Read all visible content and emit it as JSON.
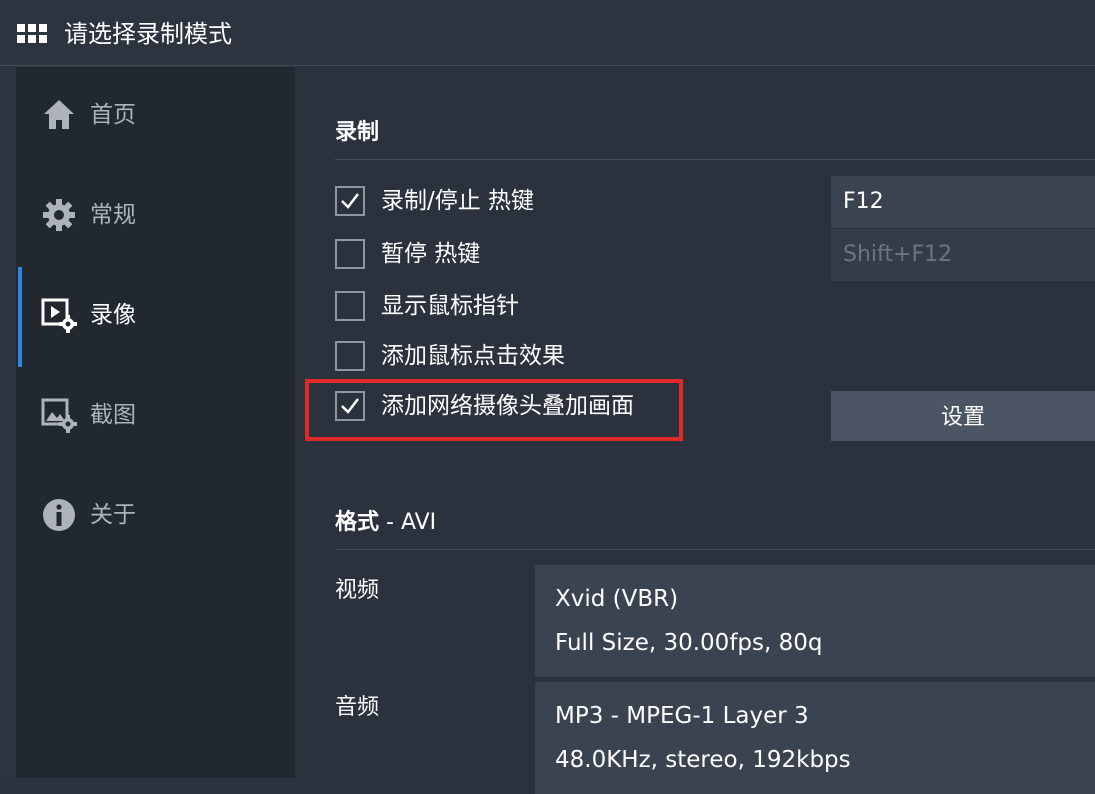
{
  "window": {
    "title": "请选择录制模式",
    "icon": "grid-icon"
  },
  "sidebar": {
    "items": [
      {
        "label": "首页",
        "icon": "home-icon",
        "active": false
      },
      {
        "label": "常规",
        "icon": "gear-icon",
        "active": false
      },
      {
        "label": "录像",
        "icon": "video-settings-icon",
        "active": true
      },
      {
        "label": "截图",
        "icon": "image-settings-icon",
        "active": false
      },
      {
        "label": "关于",
        "icon": "info-icon",
        "active": false
      }
    ],
    "active_color": "#2e86de"
  },
  "recording": {
    "section_title": "录制",
    "options": [
      {
        "label": "录制/停止 热键",
        "checked": true
      },
      {
        "label": "暂停 热键",
        "checked": false
      },
      {
        "label": "显示鼠标指针",
        "checked": false
      },
      {
        "label": "添加鼠标点击效果",
        "checked": false
      },
      {
        "label": "添加网络摄像头叠加画面",
        "checked": true
      }
    ],
    "record_hotkey": "F12",
    "pause_hotkey": "Shift+F12",
    "settings_label": "设置",
    "highlight_color": "#e02a2a"
  },
  "format": {
    "section_title": "格式",
    "section_suffix": " - AVI",
    "video_label": "视频",
    "video_codec": "Xvid (VBR)",
    "video_details": "Full Size, 30.00fps, 80q",
    "audio_label": "音频",
    "audio_codec": "MP3 - MPEG-1 Layer 3",
    "audio_details": "48.0KHz, stereo, 192kbps"
  }
}
